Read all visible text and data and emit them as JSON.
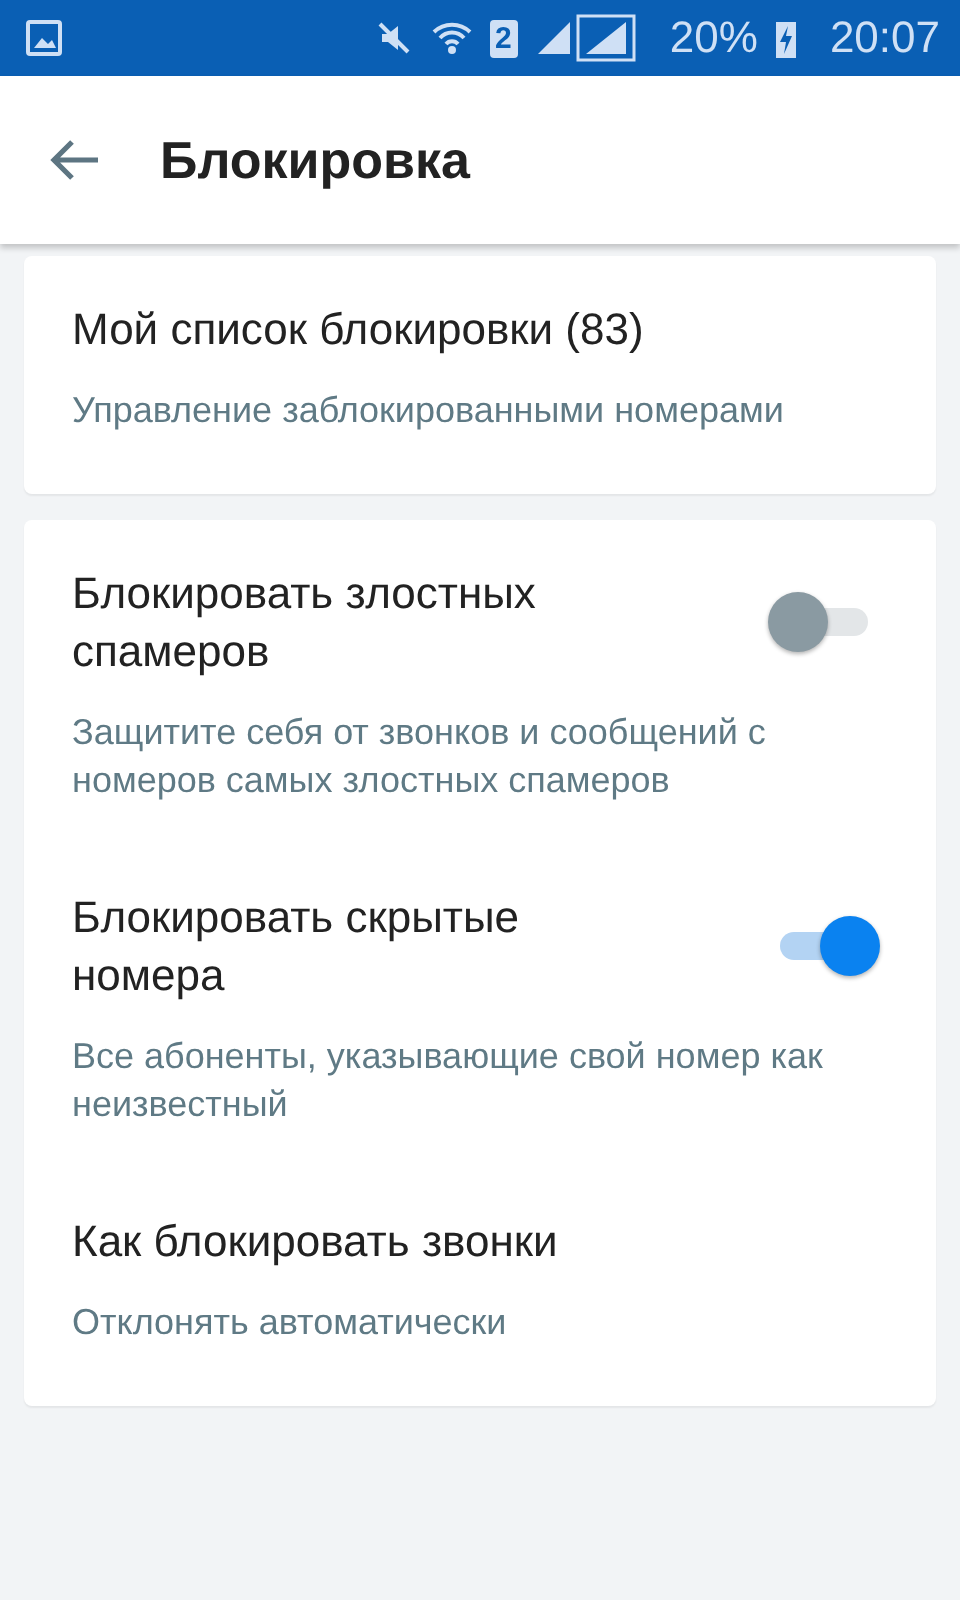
{
  "status_bar": {
    "sim": "2",
    "battery": "20%",
    "time": "20:07"
  },
  "header": {
    "title": "Блокировка"
  },
  "cards": [
    {
      "items": [
        {
          "kind": "link",
          "title": "Мой список блокировки (83)",
          "subtitle": "Управление заблокированными номерами"
        }
      ]
    },
    {
      "items": [
        {
          "kind": "toggle",
          "title": "Блокировать злостных спамеров",
          "subtitle": "Защитите себя от звонков и сообщений с номеров самых злостных спамеров",
          "on": false
        },
        {
          "kind": "toggle",
          "title": "Блокировать скрытые номера",
          "subtitle": "Все абоненты, указывающие свой номер как неизвестный",
          "on": true
        },
        {
          "kind": "link",
          "title": "Как блокировать звонки",
          "subtitle": "Отклонять автоматически"
        }
      ]
    }
  ]
}
